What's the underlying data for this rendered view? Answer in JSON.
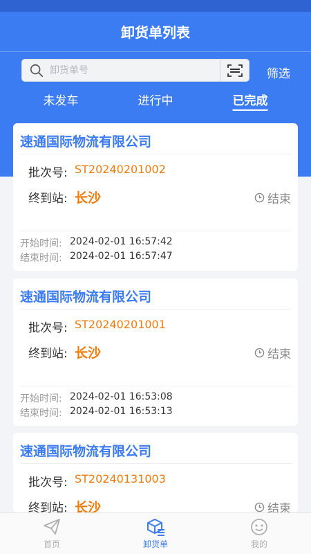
{
  "header": {
    "title": "卸货单列表",
    "search_placeholder": "卸货单号",
    "filter_label": "筛选"
  },
  "tabs": [
    {
      "label": "未发车",
      "active": false
    },
    {
      "label": "进行中",
      "active": false
    },
    {
      "label": "已完成",
      "active": true
    }
  ],
  "labels": {
    "batch": "批次号:",
    "station": "终到站:",
    "start_time": "开始时间:",
    "end_time": "结束时间:"
  },
  "cards": [
    {
      "company": "速通国际物流有限公司",
      "batch_no": "ST20240201002",
      "station": "长沙",
      "status": "结束",
      "start_time": "2024-02-01 16:57:42",
      "end_time": "2024-02-01 16:57:47"
    },
    {
      "company": "速通国际物流有限公司",
      "batch_no": "ST20240201001",
      "station": "长沙",
      "status": "结束",
      "start_time": "2024-02-01 16:53:08",
      "end_time": "2024-02-01 16:53:13"
    },
    {
      "company": "速通国际物流有限公司",
      "batch_no": "ST20240131003",
      "station": "长沙",
      "status": "结束",
      "start_time": "",
      "end_time": ""
    }
  ],
  "bottom_nav": [
    {
      "label": "首页",
      "icon": "paper-plane-icon",
      "active": false
    },
    {
      "label": "卸货单",
      "icon": "package-list-icon",
      "active": true
    },
    {
      "label": "我的",
      "icon": "smiley-face-icon",
      "active": false
    }
  ],
  "colors": {
    "primary": "#3b7cf2",
    "accent": "#f07b0d",
    "status_bar": "#2f63d1"
  }
}
